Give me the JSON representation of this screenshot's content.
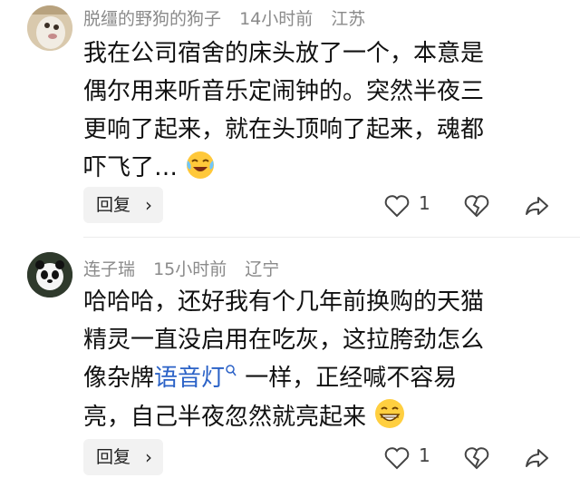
{
  "comments": [
    {
      "username": "脱缰的野狗的狗子",
      "time": "14小时前",
      "location": "江苏",
      "lines": [
        "我在公司宿舍的床头放了一个，本意是",
        "偶尔用来听音乐定闹钟的。突然半夜三",
        "更响了起来，就在头顶响了起来，魂都",
        "吓飞了…"
      ],
      "emoji": "crying-laughing-emoji",
      "reply_label": "回复",
      "like_count": "1"
    },
    {
      "username": "连子瑞",
      "time": "15小时前",
      "location": "辽宁",
      "lines": [
        "哈哈哈，还好我有个几年前换购的天猫",
        "精灵一直没启用在吃灰，这拉胯劲怎么"
      ],
      "line3_prefix": "像杂牌",
      "line3_link": "语音灯",
      "line3_suffix": " 一样，正经喊不容易",
      "line4": "亮，自己半夜忽然就亮起来",
      "emoji": "grinning-emoji",
      "reply_label": "回复",
      "like_count": "1"
    }
  ],
  "icons": {
    "like": "heart-outline-icon",
    "dislike": "broken-heart-icon",
    "share": "share-arrow-icon",
    "link_search": "search-icon",
    "reply_chevron": "chevron-right-icon"
  },
  "colors": {
    "link": "#2b62c7",
    "meta": "#8a8a8a",
    "text": "#111111"
  }
}
